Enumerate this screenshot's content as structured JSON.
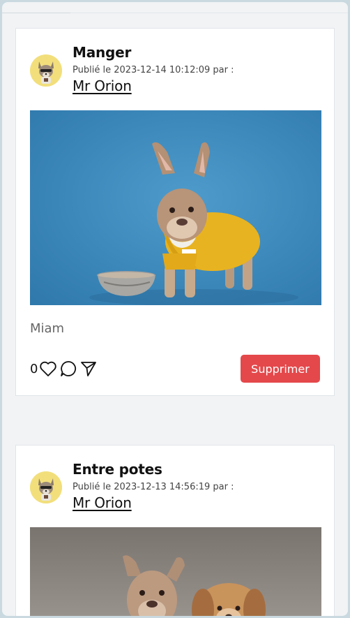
{
  "colors": {
    "page_background": "#f1f3f5",
    "card_background": "#ffffff",
    "delete_button": "#e4484b",
    "avatar_background": "#f2df7c"
  },
  "posts": [
    {
      "title": "Manger",
      "meta": "Publié le 2023-12-14 10:12:09 par :",
      "author": "Mr Orion",
      "image": "french-bulldog-yellow-shirt-with-bowl",
      "caption": "Miam",
      "likes": "0",
      "icons": [
        "heart-icon",
        "comment-icon",
        "send-icon"
      ],
      "delete_label": "Supprimer"
    },
    {
      "title": "Entre potes",
      "meta": "Publié le 2023-12-13 14:56:19 par :",
      "author": "Mr Orion",
      "image": "two-dogs-grey-background"
    }
  ]
}
